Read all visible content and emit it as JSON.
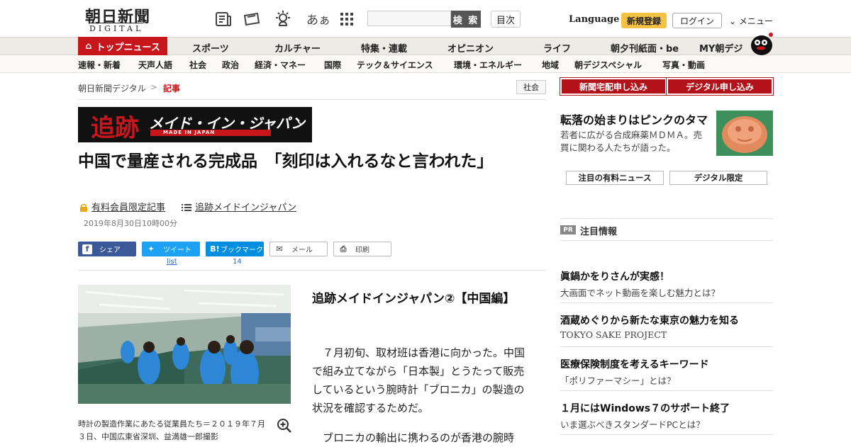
{
  "header": {
    "logo_main": "朝日新聞",
    "logo_sub": "DIGITAL",
    "font_size_label": "あぁ",
    "search_button": "検 索",
    "toc_button": "目次",
    "language": "Language",
    "signup": "新規登録",
    "login": "ログイン",
    "menu": "メニュー"
  },
  "gnav": {
    "top": "トップニュース",
    "items": [
      "スポーツ",
      "カルチャー",
      "特集・連載",
      "オピニオン",
      "ライフ",
      "朝夕刊紙面・be",
      "MY朝デジ"
    ]
  },
  "subnav": {
    "items": [
      "速報・新着",
      "天声人語",
      "社会",
      "政治",
      "経済・マネー",
      "国際",
      "テック＆サイエンス",
      "環境・エネルギー",
      "地域",
      "朝デジスペシャル",
      "写真・動画"
    ]
  },
  "breadcrumb": {
    "home": "朝日新聞デジタル",
    "sep": ">",
    "current": "記事",
    "tag": "社会"
  },
  "banner": {
    "big": "追跡",
    "title": "メイド・イン・ジャパン",
    "sub": "MADE IN JAPAN"
  },
  "article": {
    "headline": "中国で量産される完成品　「刻印は入れるなと言われた」",
    "premium_label": "有料会員限定記事",
    "series_label": "追跡メイドインジャパン",
    "date": "2019年8月30日10時00分",
    "caption": "時計の製造作業にあたる従業員たち＝２０１９年７月３日、中国広東省深圳、益満雄一郎撮影",
    "subhead": "追跡メイドインジャパン②【中国編】",
    "paragraph1": "７月初旬、取材班は香港に向かった。中国で組み立てながら「日本製」とうたって販売しているという腕時計「ブロニカ」の製造の状況を確認するためだ。",
    "paragraph2": "ブロニカの輸出に携わるのが香港の腕時"
  },
  "share": {
    "facebook": "シェア",
    "twitter": "ツイート",
    "hatena": "ブックマーク",
    "mail": "メール",
    "print": "印刷",
    "twitter_count": "list",
    "hatena_count": "14"
  },
  "sidebar": {
    "paper_subscribe": "新聞宅配申し込み",
    "digital_subscribe": "デジタル申し込み",
    "feature_title": "転落の始まりはピンクのタマ",
    "feature_text": "若者に広がる合成麻薬ＭＤＭＡ。売買に関わる人たちが語った。",
    "tab_paid_news": "注目の有料ニュース",
    "tab_digital_only": "デジタル限定",
    "pr_badge": "PR",
    "pr_title": "注目情報",
    "pr_items": [
      {
        "title": "眞鍋かをりさんが実感！",
        "sub": "大画面でネット動画を楽しむ魅力とは？"
      },
      {
        "title": "酒蔵めぐりから新たな東京の魅力を知る",
        "sub": "TOKYO SAKE PROJECT"
      },
      {
        "title": "医療保険制度を考えるキーワード",
        "sub": "「ポリファーマシー」とは？"
      },
      {
        "title": "１月にはWindows７のサポート終了",
        "sub": "いま選ぶべきスタンダードPCとは？"
      }
    ]
  },
  "colors": {
    "brand_red": "#c8161d",
    "signup_yellow": "#f5c242",
    "facebook_blue": "#3b5998",
    "twitter_blue": "#1da1f2",
    "hatena_blue": "#008fde"
  }
}
